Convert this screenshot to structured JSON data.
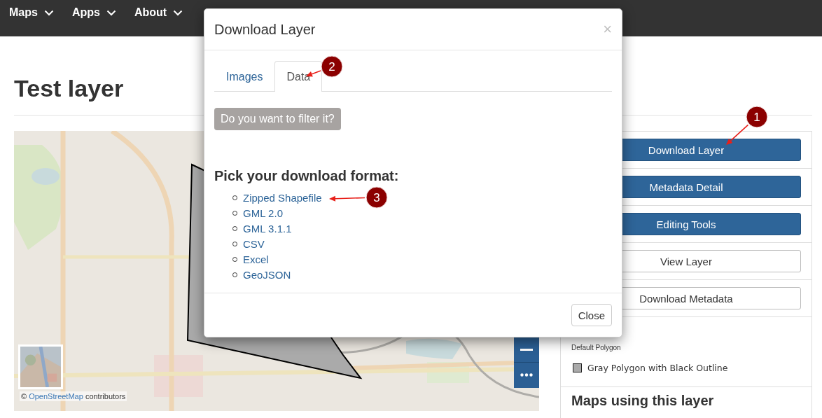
{
  "nav": {
    "items": [
      {
        "label": "Maps"
      },
      {
        "label": "Apps"
      },
      {
        "label": "About"
      }
    ]
  },
  "page": {
    "title": "Test layer"
  },
  "map": {
    "attribution": {
      "prefix": "©",
      "link": "OpenStreetMap",
      "suffix": "contributors"
    }
  },
  "sidebar": {
    "buttons": [
      {
        "label": "Download Layer",
        "primary": true
      },
      {
        "label": "Metadata Detail",
        "primary": true
      },
      {
        "label": "Editing Tools",
        "primary": true
      },
      {
        "label": "View Layer",
        "primary": false
      },
      {
        "label": "Download Metadata",
        "primary": false
      }
    ],
    "legend": {
      "subtitle": "Default Polygon",
      "items": [
        {
          "label": "Gray Polygon with Black Outline"
        }
      ]
    },
    "maps_heading": "Maps using this layer"
  },
  "modal": {
    "title": "Download Layer",
    "close_icon": "×",
    "tabs": [
      {
        "label": "Images",
        "selected": false
      },
      {
        "label": "Data",
        "selected": true
      }
    ],
    "filter_button": "Do you want to filter it?",
    "heading": "Pick your download format:",
    "formats": [
      "Zipped Shapefile",
      "GML 2.0",
      "GML 3.1.1",
      "CSV",
      "Excel",
      "GeoJSON"
    ],
    "footer_button": "Close"
  },
  "annotations": [
    {
      "number": "1"
    },
    {
      "number": "2"
    },
    {
      "number": "3"
    }
  ]
}
